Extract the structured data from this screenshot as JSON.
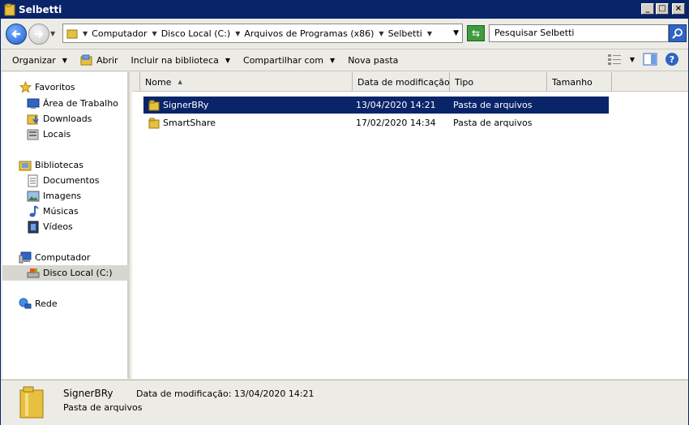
{
  "window": {
    "title": "Selbetti"
  },
  "address": {
    "crumbs": [
      "Computador",
      "Disco Local (C:)",
      "Arquivos de Programas (x86)",
      "Selbetti"
    ]
  },
  "search": {
    "placeholder": "Pesquisar Selbetti"
  },
  "toolbar": {
    "organize": "Organizar",
    "open": "Abrir",
    "include_library": "Incluir na biblioteca",
    "share": "Compartilhar com",
    "new_folder": "Nova pasta"
  },
  "nav": {
    "favorites": "Favoritos",
    "desktop": "Área de Trabalho",
    "downloads": "Downloads",
    "recent": "Locais",
    "libraries": "Bibliotecas",
    "documents": "Documentos",
    "images": "Imagens",
    "music": "Músicas",
    "videos": "Vídeos",
    "computer": "Computador",
    "local_disk": "Disco Local (C:)",
    "network": "Rede"
  },
  "columns": {
    "name": "Nome",
    "modified": "Data de modificação",
    "type": "Tipo",
    "size": "Tamanho"
  },
  "files": [
    {
      "name": "SignerBRy",
      "modified": "13/04/2020 14:21",
      "type": "Pasta de arquivos",
      "selected": true
    },
    {
      "name": "SmartShare",
      "modified": "17/02/2020 14:34",
      "type": "Pasta de arquivos",
      "selected": false
    }
  ],
  "details": {
    "name": "SignerBRy",
    "type": "Pasta de arquivos",
    "modified_text": "Data de modificação: 13/04/2020 14:21"
  },
  "colors": {
    "titlebar": "#0a246a",
    "selection": "#0a246a",
    "folder": "#e8c040"
  }
}
